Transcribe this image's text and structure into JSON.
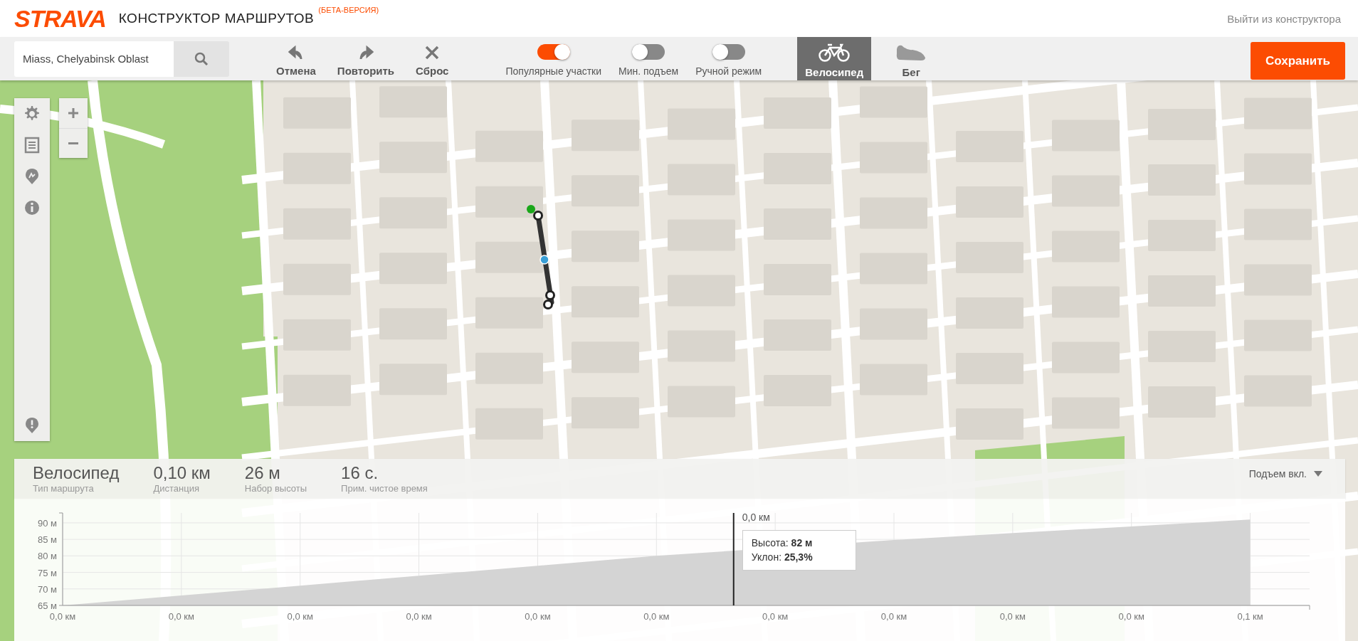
{
  "header": {
    "logo": "STRAVA",
    "title": "КОНСТРУКТОР МАРШРУТОВ",
    "badge": "(БЕТА-ВЕРСИЯ)",
    "exit_link": "Выйти из конструктора"
  },
  "toolbar": {
    "search": {
      "value": "Miass, Chelyabinsk Oblast"
    },
    "actions": [
      {
        "kind": "undo",
        "label": "Отмена"
      },
      {
        "kind": "redo",
        "label": "Повторить"
      },
      {
        "kind": "reset",
        "label": "Сброс"
      }
    ],
    "toggles": [
      {
        "label": "Популярные участки",
        "on": true
      },
      {
        "label": "Мин. подъем",
        "on": false
      },
      {
        "label": "Ручной режим",
        "on": false
      }
    ],
    "sports": [
      {
        "kind": "bike",
        "label": "Велосипед",
        "selected": true
      },
      {
        "kind": "run",
        "label": "Бег",
        "selected": false
      }
    ],
    "save_button": "Сохранить"
  },
  "map_tools": [
    {
      "kind": "settings"
    },
    {
      "kind": "list"
    },
    {
      "kind": "pin"
    },
    {
      "kind": "info"
    }
  ],
  "elevation": {
    "stats": [
      {
        "value": "Велосипед",
        "label": "Тип маршрута"
      },
      {
        "value": "0,10 км",
        "label": "Дистанция"
      },
      {
        "value": "26 м",
        "label": "Набор высоты"
      },
      {
        "value": "16 с.",
        "label": "Прим. чистое время"
      }
    ],
    "climb_dropdown": "Подъем вкл.",
    "cursor": {
      "distance": "0,0 км",
      "lines": [
        "Высота: **82 м**",
        "Уклон: **25,3%**"
      ]
    },
    "chart_data": {
      "type": "area",
      "categories": [
        "0,0 км",
        "0,0 км",
        "0,0 км",
        "0,0 км",
        "0,0 км",
        "0,0 км",
        "0,0 км",
        "0,0 км",
        "0,0 км",
        "0,0 км",
        "0,1 км"
      ],
      "series": [
        {
          "color": "#d4d4d4",
          "values": [
            65,
            68,
            71,
            74,
            77,
            80,
            null,
            84.8,
            86.9,
            88.9,
            91
          ]
        }
      ],
      "grid": true,
      "ylim": [
        65,
        93
      ],
      "yticks": [
        {
          "value": 65,
          "label": "65 м"
        },
        {
          "value": 70,
          "label": "70 м"
        },
        {
          "value": 75,
          "label": "75 м"
        },
        {
          "value": 80,
          "label": "80 м"
        },
        {
          "value": 85,
          "label": "85 м"
        },
        {
          "value": 90,
          "label": "90 м"
        }
      ]
    }
  }
}
